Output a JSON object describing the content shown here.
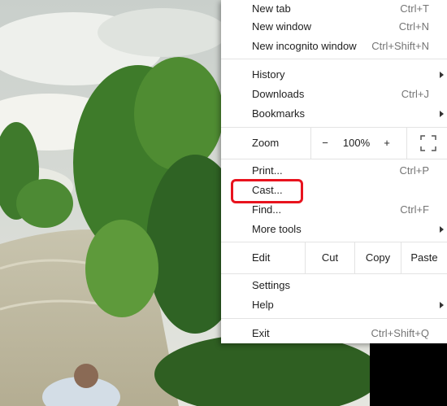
{
  "menu": {
    "items": {
      "new_tab": {
        "label": "New tab",
        "shortcut": "Ctrl+T"
      },
      "new_window": {
        "label": "New window",
        "shortcut": "Ctrl+N"
      },
      "new_incognito": {
        "label": "New incognito window",
        "shortcut": "Ctrl+Shift+N"
      },
      "history": {
        "label": "History"
      },
      "downloads": {
        "label": "Downloads",
        "shortcut": "Ctrl+J"
      },
      "bookmarks": {
        "label": "Bookmarks"
      },
      "print": {
        "label": "Print...",
        "shortcut": "Ctrl+P"
      },
      "cast": {
        "label": "Cast..."
      },
      "find": {
        "label": "Find...",
        "shortcut": "Ctrl+F"
      },
      "more_tools": {
        "label": "More tools"
      },
      "settings": {
        "label": "Settings"
      },
      "help": {
        "label": "Help"
      },
      "exit": {
        "label": "Exit",
        "shortcut": "Ctrl+Shift+Q"
      }
    },
    "zoom": {
      "label": "Zoom",
      "minus": "−",
      "level": "100%",
      "plus": "+"
    },
    "edit": {
      "label": "Edit",
      "cut": "Cut",
      "copy": "Copy",
      "paste": "Paste"
    }
  },
  "icons": {
    "fullscreen": "fullscreen-icon",
    "submenu": "chevron-right-icon"
  },
  "colors": {
    "highlight": "#e8131e"
  }
}
